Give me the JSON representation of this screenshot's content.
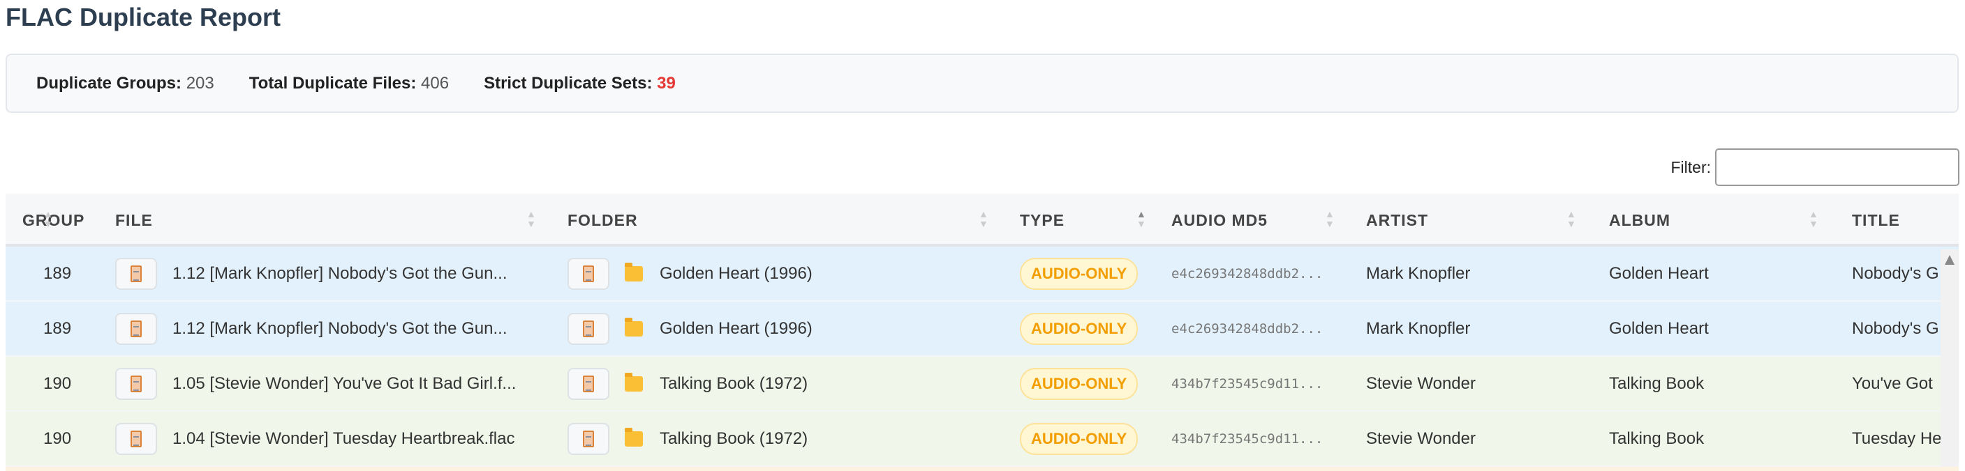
{
  "title": "FLAC Duplicate Report",
  "summary": {
    "groups_label": "Duplicate Groups:",
    "groups": "203",
    "files_label": "Total Duplicate Files:",
    "files": "406",
    "strict_label": "Strict Duplicate Sets:",
    "strict": "39"
  },
  "filter": {
    "label": "Filter:",
    "value": ""
  },
  "columns": [
    "GROUP",
    "FILE",
    "FOLDER",
    "TYPE",
    "AUDIO MD5",
    "ARTIST",
    "ALBUM",
    "TITLE"
  ],
  "rows": [
    {
      "group": "189",
      "file": "1.12 [Mark Knopfler] Nobody's Got the Gun...",
      "folder": "Golden Heart (1996)",
      "type": "AUDIO-ONLY",
      "md5": "e4c269342848ddb2...",
      "artist": "Mark Knopfler",
      "album": "Golden Heart",
      "title": "Nobody's G"
    },
    {
      "group": "189",
      "file": "1.12 [Mark Knopfler] Nobody's Got the Gun...",
      "folder": "Golden Heart (1996)",
      "type": "AUDIO-ONLY",
      "md5": "e4c269342848ddb2...",
      "artist": "Mark Knopfler",
      "album": "Golden Heart",
      "title": "Nobody's G"
    },
    {
      "group": "190",
      "file": "1.05 [Stevie Wonder] You've Got It Bad Girl.f...",
      "folder": "Talking Book (1972)",
      "type": "AUDIO-ONLY",
      "md5": "434b7f23545c9d11...",
      "artist": "Stevie Wonder",
      "album": "Talking Book",
      "title": "You've Got"
    },
    {
      "group": "190",
      "file": "1.04 [Stevie Wonder] Tuesday Heartbreak.flac",
      "folder": "Talking Book (1972)",
      "type": "AUDIO-ONLY",
      "md5": "434b7f23545c9d11...",
      "artist": "Stevie Wonder",
      "album": "Talking Book",
      "title": "Tuesday He"
    }
  ]
}
